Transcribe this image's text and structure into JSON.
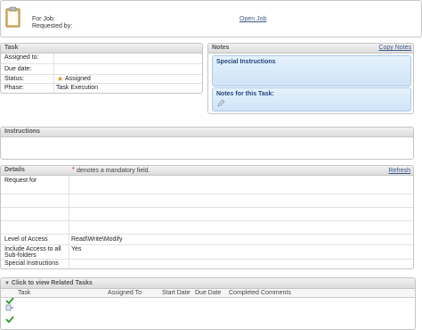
{
  "header": {
    "for_job_label": "For Job:",
    "requested_by_label": "Requested by:",
    "open_job_link": "Open Job"
  },
  "task": {
    "title": "Task",
    "fields": [
      {
        "label": "Assigned to:",
        "value": ""
      },
      {
        "label": "Due date:",
        "value": ""
      },
      {
        "label": "Status:",
        "value": "Assigned"
      },
      {
        "label": "Phase:",
        "value": "Task Execution"
      }
    ]
  },
  "notes": {
    "title": "Notes",
    "copy_link": "Copy Notes",
    "special_instructions_title": "Special Instructions",
    "task_notes_title": "Notes for this Task:"
  },
  "instructions": {
    "title": "Instructions"
  },
  "details": {
    "title": "Details",
    "mandatory_note": "denotes a mandatory field.",
    "refresh_link": "Refresh",
    "fields": [
      {
        "label": "Request for",
        "value": ""
      },
      {
        "label": "Level of Access",
        "value": "Read\\Write\\Modify"
      },
      {
        "label": "Include Access to all Sub-folders",
        "value": "Yes"
      },
      {
        "label": "Special Instructions",
        "value": ""
      }
    ]
  },
  "related_tasks": {
    "title": "Click to view Related Tasks",
    "columns": [
      "Task",
      "Assigned To",
      "Start Date",
      "Due Date",
      "Completed",
      "Comments"
    ],
    "icons": [
      "check-icon",
      "task-icon",
      "check-icon"
    ]
  },
  "colors": {
    "link": "#3b5a8a",
    "note_title": "#23457a",
    "star": "#e08a1e",
    "mandatory": "#cc0000",
    "check": "#2a9a2a"
  }
}
